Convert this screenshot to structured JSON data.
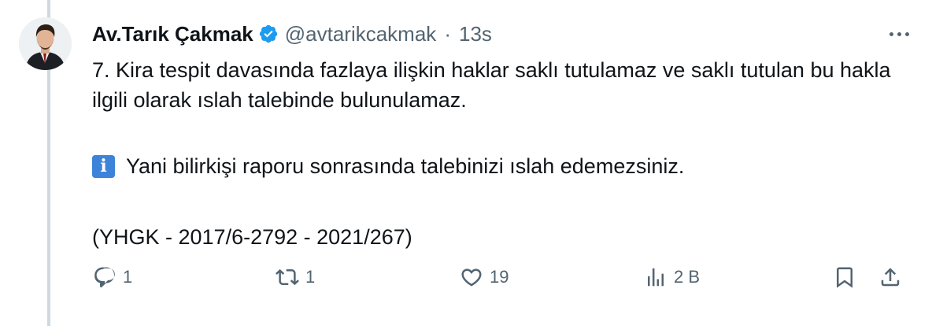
{
  "tweet": {
    "author_name": "Av.Tarık Çakmak",
    "handle": "@avtarikcakmak",
    "separator": "·",
    "time": "13s",
    "lines": [
      "7. Kira tespit davasında fazlaya ilişkin haklar saklı tutulamaz ve saklı tutulan bu hakla ilgili olarak ıslah talebinde bulunulamaz.",
      "",
      "Yani bilirkişi raporu sonrasında talebinizi ıslah edemezsiniz.",
      "",
      "(YHGK - 2017/6-2792 - 2021/267)"
    ],
    "info_icon_char": "i"
  },
  "actions": {
    "reply_count": "1",
    "retweet_count": "1",
    "like_count": "19",
    "views_count": "2 B"
  },
  "icons": {
    "verified": "verified-badge-icon",
    "info": "information-icon",
    "more": "more-dots-icon",
    "reply": "reply-icon",
    "retweet": "retweet-icon",
    "like": "heart-icon",
    "views": "views-chart-icon",
    "bookmark": "bookmark-icon",
    "share": "share-icon"
  },
  "colors": {
    "verified": "#1d9bf0",
    "info_icon": "#3d83d9",
    "secondary_text": "#536471",
    "thread_line": "#cfd9de"
  }
}
